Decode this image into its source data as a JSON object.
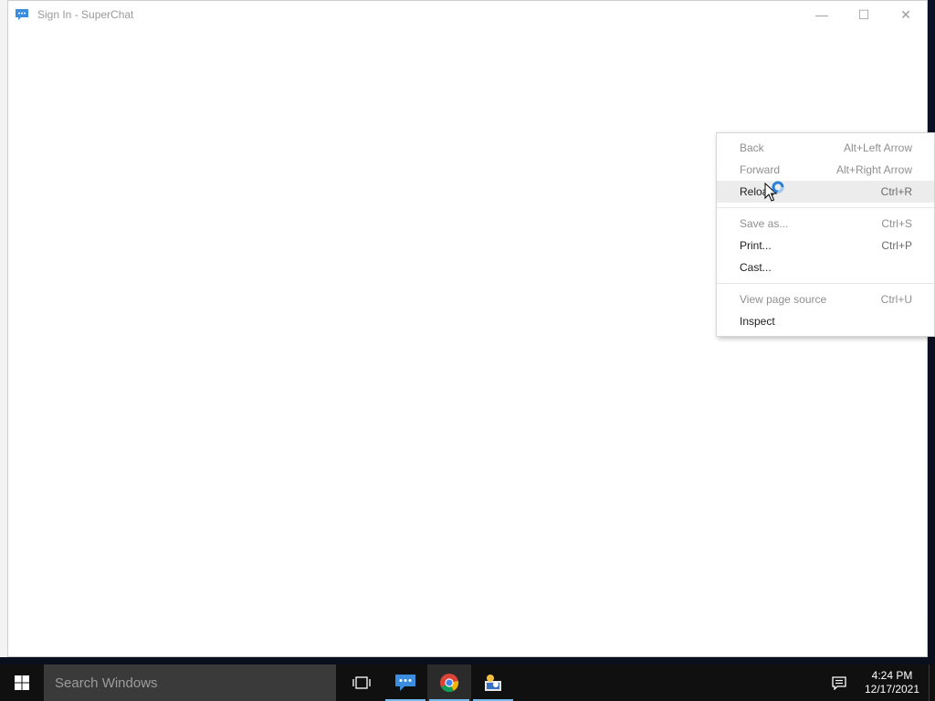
{
  "window": {
    "title": "Sign In - SuperChat",
    "controls": {
      "minimize": "—",
      "maximize": "☐",
      "close": "✕"
    }
  },
  "context_menu": {
    "items": [
      {
        "label": "Back",
        "shortcut": "Alt+Left Arrow",
        "disabled": true
      },
      {
        "label": "Forward",
        "shortcut": "Alt+Right Arrow",
        "disabled": true
      },
      {
        "label": "Reload",
        "shortcut": "Ctrl+R",
        "disabled": false
      },
      {
        "label": "Save as...",
        "shortcut": "Ctrl+S",
        "disabled": true
      },
      {
        "label": "Print...",
        "shortcut": "Ctrl+P",
        "disabled": false
      },
      {
        "label": "Cast...",
        "shortcut": "",
        "disabled": false
      },
      {
        "label": "View page source",
        "shortcut": "Ctrl+U",
        "disabled": true
      },
      {
        "label": "Inspect",
        "shortcut": "",
        "disabled": false
      }
    ]
  },
  "taskbar": {
    "search_placeholder": "Search Windows",
    "clock": {
      "time": "4:24 PM",
      "date": "12/17/2021"
    },
    "apps": [
      {
        "name": "superchat",
        "icon": "chat-bubbles-icon"
      },
      {
        "name": "chrome",
        "icon": "chrome-icon"
      },
      {
        "name": "network-tool",
        "icon": "network-user-icon"
      }
    ]
  },
  "colors": {
    "accent": "#3b8de0",
    "taskbar": "#101010",
    "search_box": "#3a3a3a",
    "active_underline": "#76b9ed"
  }
}
